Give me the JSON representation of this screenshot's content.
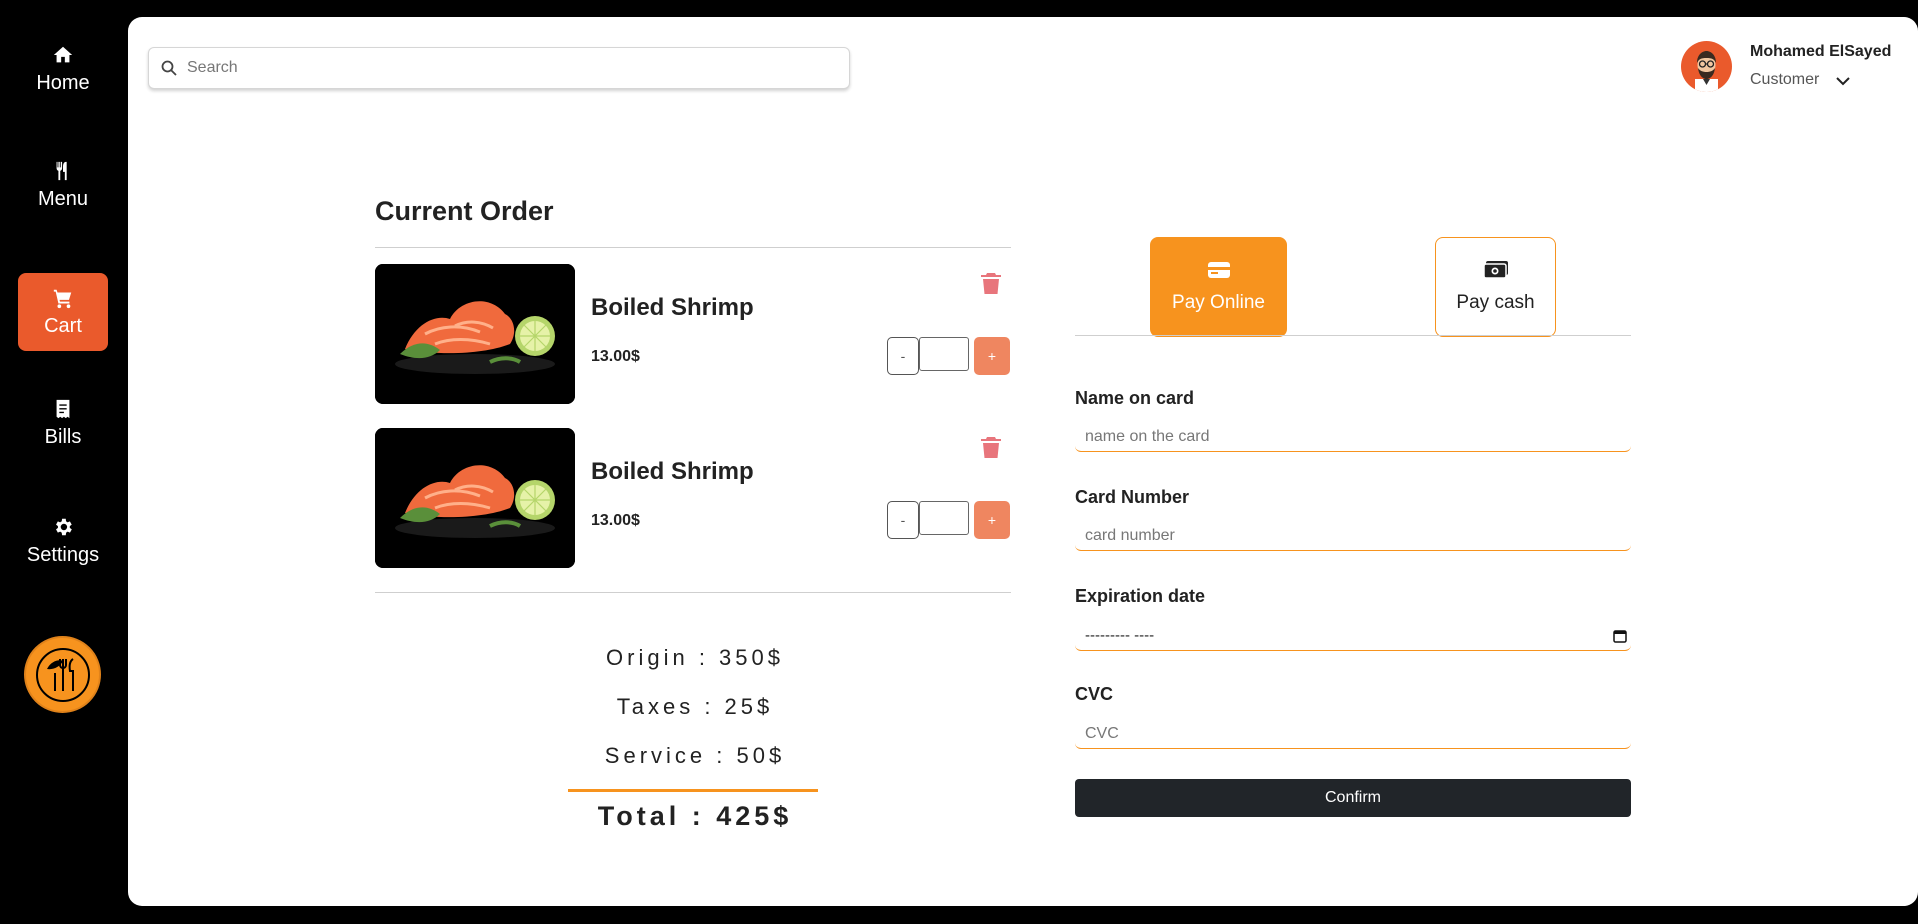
{
  "sidebar": {
    "items": [
      {
        "label": "Home",
        "icon": "home-icon"
      },
      {
        "label": "Menu",
        "icon": "utensils-icon"
      },
      {
        "label": "Cart",
        "icon": "cart-icon",
        "active": true
      },
      {
        "label": "Bills",
        "icon": "receipt-icon"
      },
      {
        "label": "Settings",
        "icon": "gear-icon"
      }
    ],
    "logo": "restaurant-logo"
  },
  "header": {
    "search_placeholder": "Search",
    "user_name": "Mohamed ElSayed",
    "user_role": "Customer"
  },
  "order": {
    "title": "Current Order",
    "items": [
      {
        "name": "Boiled Shrimp",
        "price": "13.00$",
        "qty": "",
        "minus_label": "-",
        "plus_label": "+"
      },
      {
        "name": "Boiled Shrimp",
        "price": "13.00$",
        "qty": "",
        "minus_label": "-",
        "plus_label": "+"
      }
    ],
    "origin": "Origin : 350$",
    "taxes": "Taxes : 25$",
    "service": "Service : 50$",
    "total": "Total : 425$"
  },
  "payment": {
    "tabs": [
      {
        "label": "Pay Online",
        "icon": "credit-card-icon",
        "active": true
      },
      {
        "label": "Pay cash",
        "icon": "money-icon",
        "active": false
      }
    ],
    "fields": {
      "name_label": "Name on card",
      "name_placeholder": "name on the card",
      "card_label": "Card Number",
      "card_placeholder": "card number",
      "exp_label": "Expiration date",
      "exp_value": "--------- ----",
      "cvc_label": "CVC",
      "cvc_placeholder": "CVC"
    },
    "confirm_label": "Confirm"
  },
  "colors": {
    "accent": "#f7931e",
    "active_nav": "#ea5a2c",
    "plus_button": "#ef8660",
    "trash": "#e8757c",
    "confirm": "#212529"
  }
}
